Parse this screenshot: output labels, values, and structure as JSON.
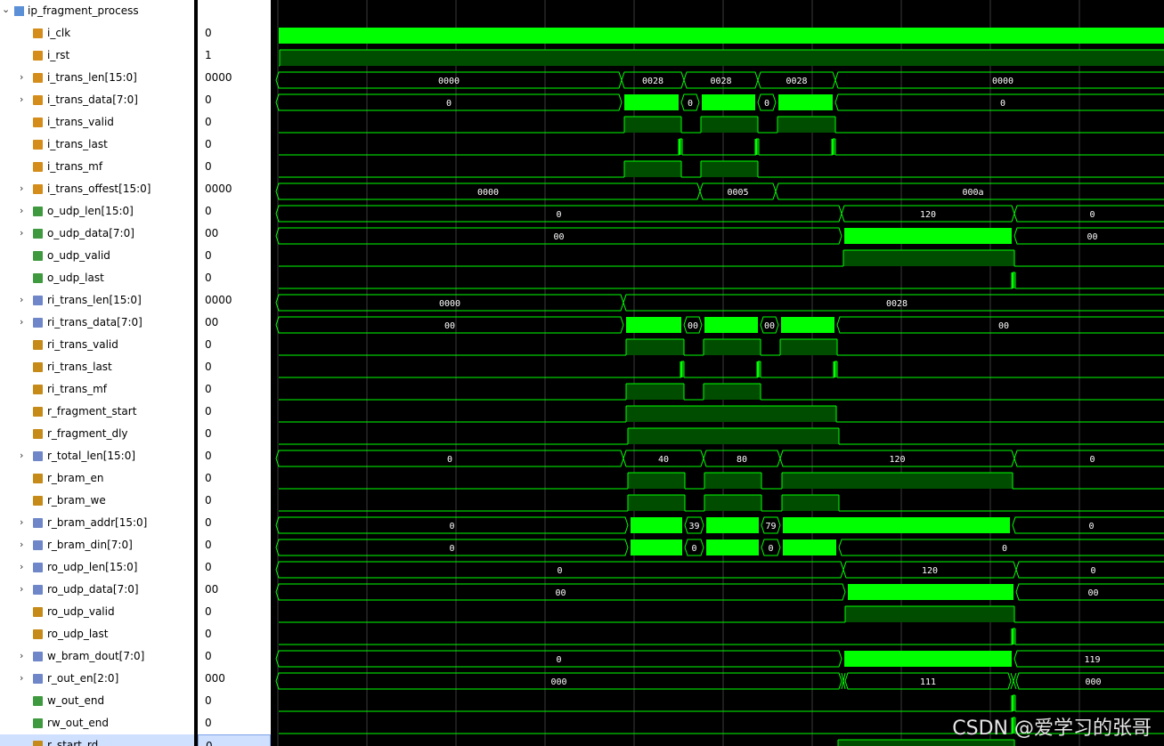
{
  "top": {
    "name": "ip_fragment_process"
  },
  "signals": [
    {
      "name": "i_clk",
      "value": "0",
      "expandable": false,
      "icon": "input-bit"
    },
    {
      "name": "i_rst",
      "value": "1",
      "expandable": false,
      "icon": "input-bit"
    },
    {
      "name": "i_trans_len[15:0]",
      "value": "0000",
      "expandable": true,
      "icon": "input-bus"
    },
    {
      "name": "i_trans_data[7:0]",
      "value": "0",
      "expandable": true,
      "icon": "input-bus"
    },
    {
      "name": "i_trans_valid",
      "value": "0",
      "expandable": false,
      "icon": "input-bit"
    },
    {
      "name": "i_trans_last",
      "value": "0",
      "expandable": false,
      "icon": "input-bit"
    },
    {
      "name": "i_trans_mf",
      "value": "0",
      "expandable": false,
      "icon": "input-bit"
    },
    {
      "name": "i_trans_offest[15:0]",
      "value": "0000",
      "expandable": true,
      "icon": "input-bus"
    },
    {
      "name": "o_udp_len[15:0]",
      "value": "0",
      "expandable": true,
      "icon": "output-bus"
    },
    {
      "name": "o_udp_data[7:0]",
      "value": "00",
      "expandable": true,
      "icon": "output-bus"
    },
    {
      "name": "o_udp_valid",
      "value": "0",
      "expandable": false,
      "icon": "output-bit"
    },
    {
      "name": "o_udp_last",
      "value": "0",
      "expandable": false,
      "icon": "output-bit"
    },
    {
      "name": "ri_trans_len[15:0]",
      "value": "0000",
      "expandable": true,
      "icon": "reg-bus"
    },
    {
      "name": "ri_trans_data[7:0]",
      "value": "00",
      "expandable": true,
      "icon": "reg-bus"
    },
    {
      "name": "ri_trans_valid",
      "value": "0",
      "expandable": false,
      "icon": "reg-bit"
    },
    {
      "name": "ri_trans_last",
      "value": "0",
      "expandable": false,
      "icon": "reg-bit"
    },
    {
      "name": "ri_trans_mf",
      "value": "0",
      "expandable": false,
      "icon": "reg-bit"
    },
    {
      "name": "r_fragment_start",
      "value": "0",
      "expandable": false,
      "icon": "reg-bit"
    },
    {
      "name": "r_fragment_dly",
      "value": "0",
      "expandable": false,
      "icon": "reg-bit"
    },
    {
      "name": "r_total_len[15:0]",
      "value": "0",
      "expandable": true,
      "icon": "reg-bus"
    },
    {
      "name": "r_bram_en",
      "value": "0",
      "expandable": false,
      "icon": "reg-bit"
    },
    {
      "name": "r_bram_we",
      "value": "0",
      "expandable": false,
      "icon": "reg-bit"
    },
    {
      "name": "r_bram_addr[15:0]",
      "value": "0",
      "expandable": true,
      "icon": "reg-bus"
    },
    {
      "name": "r_bram_din[7:0]",
      "value": "0",
      "expandable": true,
      "icon": "reg-bus"
    },
    {
      "name": "ro_udp_len[15:0]",
      "value": "0",
      "expandable": true,
      "icon": "reg-bus"
    },
    {
      "name": "ro_udp_data[7:0]",
      "value": "00",
      "expandable": true,
      "icon": "reg-bus"
    },
    {
      "name": "ro_udp_valid",
      "value": "0",
      "expandable": false,
      "icon": "reg-bit"
    },
    {
      "name": "ro_udp_last",
      "value": "0",
      "expandable": false,
      "icon": "reg-bit"
    },
    {
      "name": "w_bram_dout[7:0]",
      "value": "0",
      "expandable": true,
      "icon": "wire-bus"
    },
    {
      "name": "r_out_en[2:0]",
      "value": "000",
      "expandable": true,
      "icon": "reg-bus"
    },
    {
      "name": "w_out_end",
      "value": "0",
      "expandable": false,
      "icon": "wire-bit"
    },
    {
      "name": "rw_out_end",
      "value": "0",
      "expandable": false,
      "icon": "wire-bit"
    },
    {
      "name": "r_start_rd",
      "value": "0",
      "expandable": false,
      "icon": "reg-bit",
      "selected": true
    }
  ],
  "waves": [
    {
      "type": "clk"
    },
    {
      "type": "bit",
      "segs": [
        [
          0,
          1,
          0
        ],
        [
          1,
          998,
          1
        ]
      ]
    },
    {
      "type": "bus",
      "segs": [
        [
          0,
          385,
          "0000"
        ],
        [
          385,
          455,
          "0028"
        ],
        [
          455,
          538,
          "0028"
        ],
        [
          538,
          625,
          "0028"
        ],
        [
          625,
          998,
          "0000"
        ]
      ]
    },
    {
      "type": "bus",
      "segs": [
        [
          0,
          385,
          "0"
        ],
        [
          385,
          452,
          "DENSE"
        ],
        [
          452,
          472,
          "0"
        ],
        [
          472,
          538,
          "DENSE"
        ],
        [
          538,
          558,
          "0"
        ],
        [
          558,
          625,
          "DENSE"
        ],
        [
          625,
          998,
          "0"
        ]
      ]
    },
    {
      "type": "bit",
      "segs": [
        [
          0,
          388,
          0
        ],
        [
          388,
          452,
          1
        ],
        [
          452,
          474,
          0
        ],
        [
          474,
          538,
          1
        ],
        [
          538,
          560,
          0
        ],
        [
          560,
          625,
          1
        ],
        [
          625,
          998,
          0
        ]
      ]
    },
    {
      "type": "bit",
      "segs": [
        [
          0,
          450,
          0
        ],
        [
          450,
          453,
          1
        ],
        [
          453,
          536,
          0
        ],
        [
          536,
          539,
          1
        ],
        [
          539,
          622,
          0
        ],
        [
          622,
          625,
          1
        ],
        [
          625,
          998,
          0
        ]
      ]
    },
    {
      "type": "bit",
      "segs": [
        [
          0,
          388,
          0
        ],
        [
          388,
          452,
          1
        ],
        [
          452,
          474,
          0
        ],
        [
          474,
          538,
          1
        ],
        [
          538,
          998,
          0
        ]
      ]
    },
    {
      "type": "bus",
      "segs": [
        [
          0,
          473,
          "0000"
        ],
        [
          473,
          558,
          "0005"
        ],
        [
          558,
          998,
          "000a"
        ]
      ]
    },
    {
      "type": "bus",
      "segs": [
        [
          0,
          632,
          "0"
        ],
        [
          632,
          826,
          "120"
        ],
        [
          826,
          998,
          "0"
        ]
      ]
    },
    {
      "type": "bus",
      "segs": [
        [
          0,
          632,
          "00"
        ],
        [
          632,
          826,
          "DENSE"
        ],
        [
          826,
          998,
          "00"
        ]
      ]
    },
    {
      "type": "bit",
      "segs": [
        [
          0,
          634,
          0
        ],
        [
          634,
          826,
          1
        ],
        [
          826,
          998,
          0
        ]
      ]
    },
    {
      "type": "bit",
      "segs": [
        [
          0,
          824,
          0
        ],
        [
          824,
          827,
          1
        ],
        [
          827,
          998,
          0
        ]
      ]
    },
    {
      "type": "bus",
      "segs": [
        [
          0,
          387,
          "0000"
        ],
        [
          387,
          998,
          "0028"
        ]
      ]
    },
    {
      "type": "bus",
      "segs": [
        [
          0,
          387,
          "00"
        ],
        [
          387,
          455,
          "DENSE"
        ],
        [
          455,
          475,
          "00"
        ],
        [
          475,
          541,
          "DENSE"
        ],
        [
          541,
          561,
          "00"
        ],
        [
          561,
          627,
          "DENSE"
        ],
        [
          627,
          998,
          "00"
        ]
      ]
    },
    {
      "type": "bit",
      "segs": [
        [
          0,
          390,
          0
        ],
        [
          390,
          455,
          1
        ],
        [
          455,
          477,
          0
        ],
        [
          477,
          541,
          1
        ],
        [
          541,
          563,
          0
        ],
        [
          563,
          627,
          1
        ],
        [
          627,
          998,
          0
        ]
      ]
    },
    {
      "type": "bit",
      "segs": [
        [
          0,
          452,
          0
        ],
        [
          452,
          455,
          1
        ],
        [
          455,
          538,
          0
        ],
        [
          538,
          541,
          1
        ],
        [
          541,
          624,
          0
        ],
        [
          624,
          627,
          1
        ],
        [
          627,
          998,
          0
        ]
      ]
    },
    {
      "type": "bit",
      "segs": [
        [
          0,
          390,
          0
        ],
        [
          390,
          455,
          1
        ],
        [
          455,
          477,
          0
        ],
        [
          477,
          541,
          1
        ],
        [
          541,
          998,
          0
        ]
      ]
    },
    {
      "type": "bit",
      "segs": [
        [
          0,
          390,
          0
        ],
        [
          390,
          626,
          1
        ],
        [
          626,
          998,
          0
        ]
      ]
    },
    {
      "type": "bit",
      "segs": [
        [
          0,
          392,
          0
        ],
        [
          392,
          629,
          1
        ],
        [
          629,
          998,
          0
        ]
      ]
    },
    {
      "type": "bus",
      "segs": [
        [
          0,
          387,
          "0"
        ],
        [
          387,
          477,
          "40"
        ],
        [
          477,
          563,
          "80"
        ],
        [
          563,
          826,
          "120"
        ],
        [
          826,
          998,
          "0"
        ]
      ]
    },
    {
      "type": "bit",
      "segs": [
        [
          0,
          392,
          0
        ],
        [
          392,
          456,
          1
        ],
        [
          456,
          478,
          0
        ],
        [
          478,
          542,
          1
        ],
        [
          542,
          565,
          0
        ],
        [
          565,
          824,
          1
        ],
        [
          824,
          998,
          0
        ]
      ]
    },
    {
      "type": "bit",
      "segs": [
        [
          0,
          392,
          0
        ],
        [
          392,
          456,
          1
        ],
        [
          456,
          478,
          0
        ],
        [
          478,
          542,
          1
        ],
        [
          542,
          565,
          0
        ],
        [
          565,
          629,
          1
        ],
        [
          629,
          998,
          0
        ]
      ]
    },
    {
      "type": "bus",
      "segs": [
        [
          0,
          392,
          "0"
        ],
        [
          392,
          456,
          "DENSE"
        ],
        [
          456,
          477,
          "39"
        ],
        [
          477,
          542,
          "DENSE"
        ],
        [
          542,
          563,
          "79"
        ],
        [
          563,
          824,
          "DENSE"
        ],
        [
          824,
          998,
          "0"
        ]
      ]
    },
    {
      "type": "bus",
      "segs": [
        [
          0,
          392,
          "0"
        ],
        [
          392,
          456,
          "DENSE"
        ],
        [
          456,
          477,
          "0"
        ],
        [
          477,
          542,
          "DENSE"
        ],
        [
          542,
          563,
          "0"
        ],
        [
          563,
          629,
          "DENSE"
        ],
        [
          629,
          998,
          "0"
        ]
      ]
    },
    {
      "type": "bus",
      "segs": [
        [
          0,
          634,
          "0"
        ],
        [
          634,
          828,
          "120"
        ],
        [
          828,
          998,
          "0"
        ]
      ]
    },
    {
      "type": "bus",
      "segs": [
        [
          0,
          636,
          "00"
        ],
        [
          636,
          828,
          "DENSE"
        ],
        [
          828,
          998,
          "00"
        ]
      ]
    },
    {
      "type": "bit",
      "segs": [
        [
          0,
          636,
          0
        ],
        [
          636,
          826,
          1
        ],
        [
          826,
          998,
          0
        ]
      ]
    },
    {
      "type": "bit",
      "segs": [
        [
          0,
          824,
          0
        ],
        [
          824,
          827,
          1
        ],
        [
          827,
          998,
          0
        ]
      ]
    },
    {
      "type": "bus",
      "segs": [
        [
          0,
          632,
          "0"
        ],
        [
          632,
          826,
          "DENSE"
        ],
        [
          826,
          998,
          "119"
        ]
      ]
    },
    {
      "type": "bus",
      "segs": [
        [
          0,
          632,
          "000"
        ],
        [
          632,
          636,
          "X"
        ],
        [
          636,
          822,
          "111"
        ],
        [
          822,
          828,
          "X"
        ],
        [
          828,
          998,
          "000"
        ]
      ]
    },
    {
      "type": "bit",
      "segs": [
        [
          0,
          824,
          0
        ],
        [
          824,
          827,
          1
        ],
        [
          827,
          998,
          0
        ]
      ]
    },
    {
      "type": "bit",
      "segs": [
        [
          0,
          824,
          0
        ],
        [
          824,
          827,
          1
        ],
        [
          827,
          998,
          0
        ]
      ]
    },
    {
      "type": "bit",
      "segs": [
        [
          0,
          628,
          0
        ],
        [
          628,
          826,
          1
        ],
        [
          826,
          998,
          0
        ]
      ]
    }
  ],
  "grid_x": [
    3,
    103,
    203,
    303,
    403,
    503,
    603,
    703,
    803,
    903
  ],
  "colors": {
    "wave": "#00ff00",
    "bit_fill": "#004d00",
    "grid": "#3a3a3a",
    "bus_text": "#ffffff"
  },
  "watermark": "CSDN @爱学习的张哥"
}
